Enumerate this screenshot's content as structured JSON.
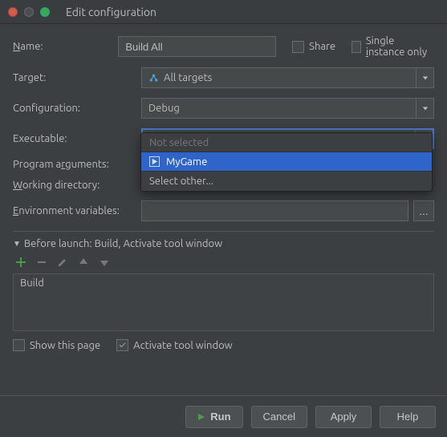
{
  "window": {
    "title": "Edit configuration"
  },
  "nameRow": {
    "label": "Name:",
    "value": "Build All"
  },
  "share": {
    "label": "Share",
    "checked": false
  },
  "singleInstance": {
    "label": "Single instance only",
    "checked": false
  },
  "target": {
    "label": "Target:",
    "value": "All targets"
  },
  "configuration": {
    "label": "Configuration:",
    "value": "Debug"
  },
  "executable": {
    "label": "Executable:",
    "value": "MyGame",
    "options": {
      "notSelected": "Not selected",
      "mygame": "MyGame",
      "selectOther": "Select other..."
    }
  },
  "programArgs": {
    "label": "Program arguments:",
    "value": ""
  },
  "workingDir": {
    "label": "Working directory:",
    "value": ""
  },
  "envVars": {
    "label": "Environment variables:",
    "value": "",
    "browse": "..."
  },
  "before": {
    "header": "Before launch: Build, Activate tool window",
    "items": {
      "build": "Build"
    }
  },
  "bottom": {
    "showThisPage": {
      "label": "Show this page",
      "checked": false
    },
    "activateTool": {
      "label": "Activate tool window",
      "checked": true
    }
  },
  "footer": {
    "run": "Run",
    "cancel": "Cancel",
    "apply": "Apply",
    "help": "Help"
  }
}
